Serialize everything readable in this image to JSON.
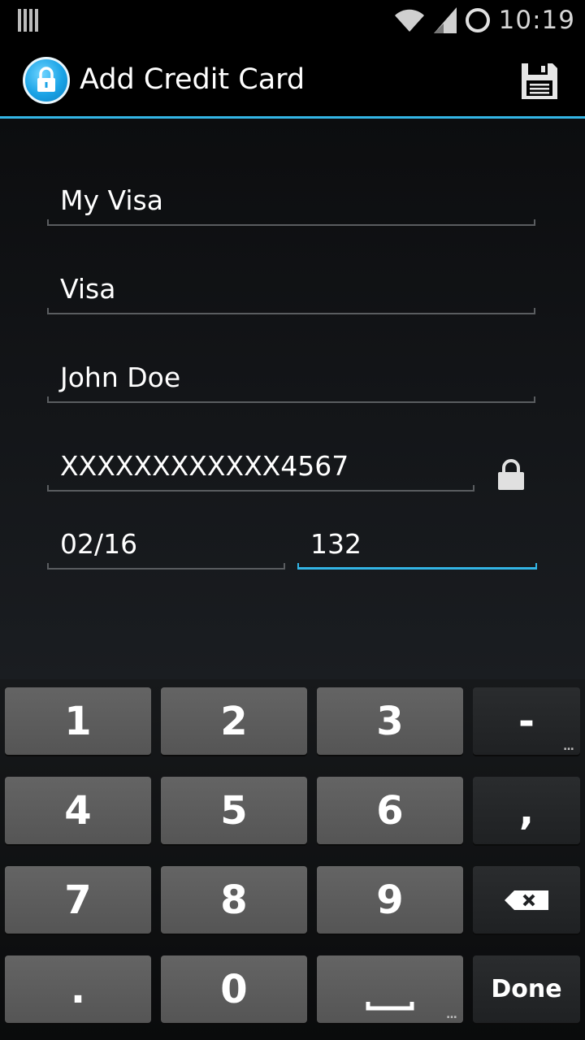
{
  "status_bar": {
    "time": "10:19",
    "icons": [
      "notification-bars-icon",
      "wifi-icon",
      "signal-icon",
      "sync-circle-icon"
    ]
  },
  "action_bar": {
    "title": "Add Credit Card",
    "app_icon": "lock-app-icon",
    "save_icon": "save-floppy-icon",
    "accent_color": "#33b5e5"
  },
  "form": {
    "card_label": "My Visa",
    "card_type": "Visa",
    "card_holder": "John Doe",
    "card_number": "XXXXXXXXXXXX4567",
    "expiry": "02/16",
    "cvv": "132",
    "focused_field": "cvv"
  },
  "keyboard": {
    "rows": [
      [
        "1",
        "2",
        "3",
        "-"
      ],
      [
        "4",
        "5",
        "6",
        ","
      ],
      [
        "7",
        "8",
        "9",
        "⌫"
      ],
      [
        ".",
        "0",
        "␣",
        "Done"
      ]
    ],
    "minus_hint": "...",
    "space_hint": "...",
    "done_label": "Done"
  }
}
